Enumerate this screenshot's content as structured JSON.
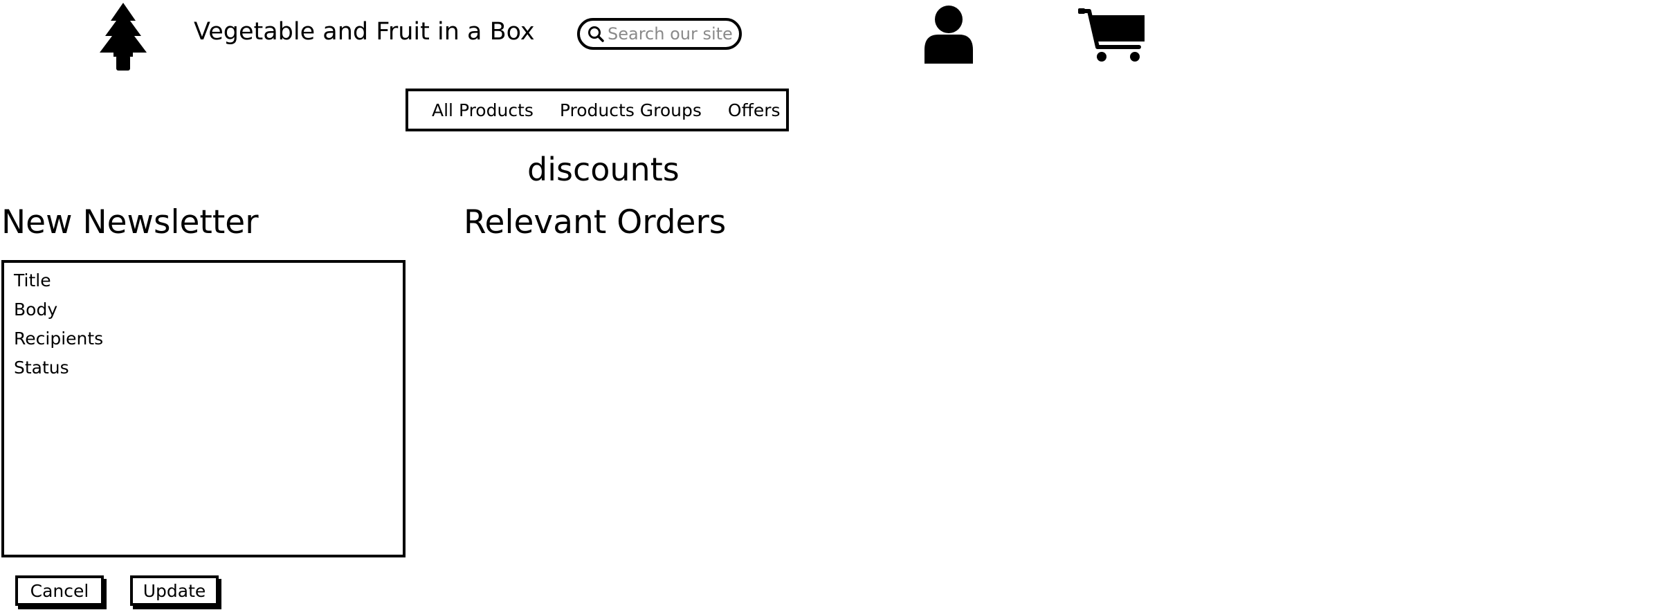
{
  "header": {
    "brand_title": "Vegetable and Fruit in a Box",
    "logo_icon": "tree-icon",
    "search": {
      "placeholder": "Search our site",
      "value": "",
      "icon": "search-icon"
    },
    "account_icon": "user-icon",
    "cart_icon": "cart-icon"
  },
  "nav": {
    "items": [
      {
        "label": "All Products"
      },
      {
        "label": "Products Groups"
      },
      {
        "label": "Offers"
      }
    ]
  },
  "page": {
    "section_title": "discounts"
  },
  "newsletter": {
    "heading": "New Newsletter",
    "fields": [
      {
        "label": "Title"
      },
      {
        "label": "Body"
      },
      {
        "label": "Recipients"
      },
      {
        "label": "Status"
      }
    ],
    "cancel_label": "Cancel",
    "update_label": "Update"
  },
  "orders": {
    "heading": "Relevant Orders"
  }
}
